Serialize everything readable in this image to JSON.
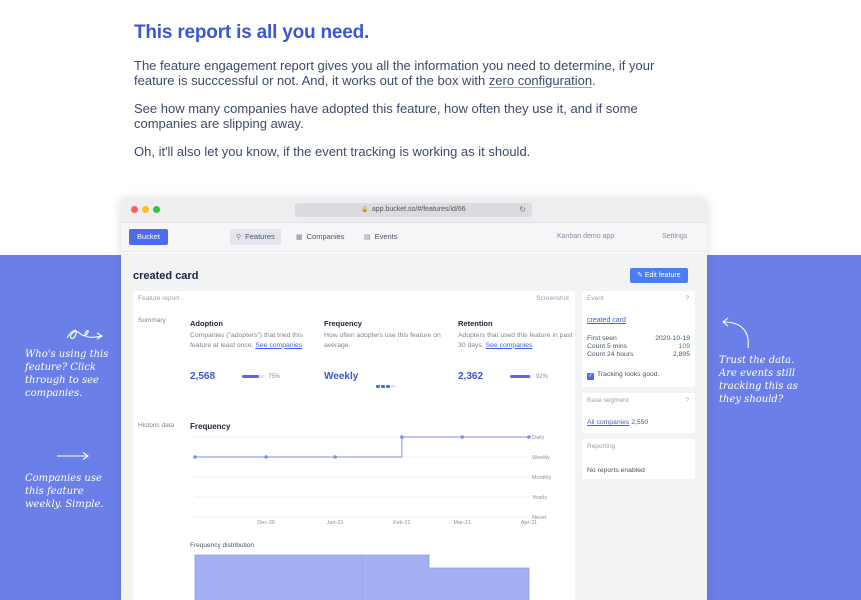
{
  "intro": {
    "heading": "This report is all you need.",
    "p1_text": "The feature engagement report gives you all the information you need to determine, if your feature is succcessful or not. And, it works out of the box with ",
    "p1_link": "zero configuration",
    "p1_end": ".",
    "p2": "See how many companies have adopted this feature, how often they use it, and if some companies are slipping away.",
    "p3": "Oh, it'll also let you know, if the event tracking is working as it should."
  },
  "notes": {
    "left_1": "Who's using this feature? Click through to see companies.",
    "left_2": "Companies use this feature weekly. Simple.",
    "right": "Trust the data. Are events still tracking this as they should?"
  },
  "browser": {
    "url": "app.bucket.so/#/features/id/66"
  },
  "nav": {
    "brand": "Bucket",
    "tabs": [
      {
        "label": "Features",
        "icon": "features-icon"
      },
      {
        "label": "Companies",
        "icon": "companies-icon"
      },
      {
        "label": "Events",
        "icon": "events-icon"
      }
    ],
    "app_name": "Kanban demo app",
    "settings": "Settings"
  },
  "page": {
    "title": "created card",
    "edit_button": "Edit feature"
  },
  "report": {
    "header_label": "Feature report",
    "screenshot_label": "Screenshot",
    "summary_label": "Summary",
    "historic_label": "Historic data",
    "adoption": {
      "title": "Adoption",
      "desc": "Companies (\"adopters\") that tried this feature at least once. ",
      "link": "See companies",
      "value": "2,568",
      "percent_label": "75%",
      "fraction": 0.75
    },
    "frequency": {
      "title": "Frequency",
      "desc": "How often adopters use this feature on average.",
      "value": "Weekly",
      "level": 3,
      "levels": 4
    },
    "retention": {
      "title": "Retention",
      "desc": "Adopters that used this feature in past 30 days. ",
      "link": "See companies",
      "value": "2,362",
      "percent_label": "92%",
      "fraction": 0.92
    },
    "chart_title": "Frequency",
    "distribution_title": "Frequency distribution"
  },
  "chart_data": {
    "type": "line",
    "title": "Frequency",
    "x_ticks": [
      "Dec-20",
      "Jan-21",
      "Feb-21",
      "Mar-21",
      "Apr-21"
    ],
    "y_ticks": [
      "Daily",
      "Weekly",
      "Monthly",
      "Yearly",
      "Never"
    ],
    "series": [
      {
        "x": [
          "2020-11-17",
          "2020-12-20",
          "2021-01-21",
          "2021-02-21",
          "2021-03-21",
          "2021-04-21"
        ],
        "y": [
          "Weekly",
          "Weekly",
          "Weekly",
          "Daily",
          "Daily",
          "Daily"
        ]
      }
    ],
    "grid": true
  },
  "side": {
    "event": {
      "label": "Event",
      "help": "?",
      "name": "created card",
      "rows": [
        {
          "k": "First seen",
          "v": "2020-10-19",
          "highlight": false
        },
        {
          "k": "Count 5 mins",
          "v": "109",
          "highlight": true
        },
        {
          "k": "Count 24 hours",
          "v": "2,895",
          "highlight": false
        }
      ],
      "tracking": "Tracking looks good."
    },
    "segment": {
      "label": "Base segment",
      "help": "?",
      "link": "All companies",
      "count": " 2,550"
    },
    "reporting": {
      "label": "Reporting",
      "empty": "No reports enabled"
    }
  },
  "colors": {
    "accent": "#3b56d6",
    "band": "#6b7fe8",
    "link": "#3b63e6",
    "success": "#2aa84a"
  }
}
